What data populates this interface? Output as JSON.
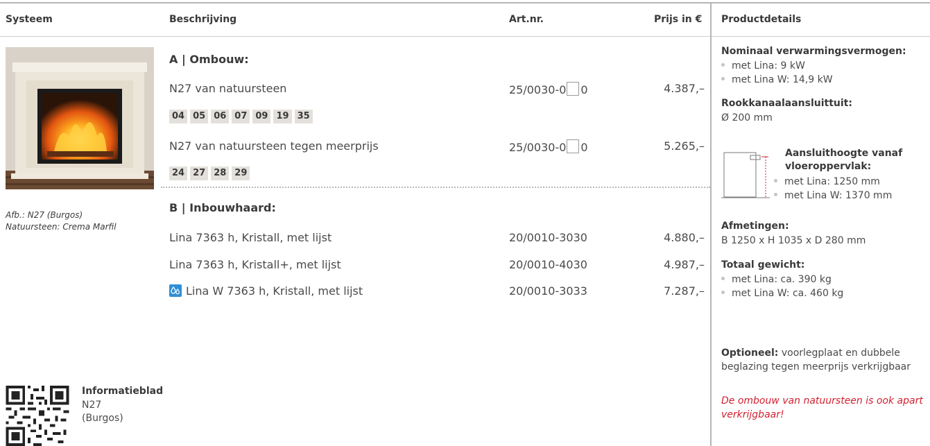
{
  "header": {
    "systeem": "Systeem",
    "beschrijving": "Beschrijving",
    "artnr": "Art.nr.",
    "prijs": "Prijs in €",
    "productdetails": "Productdetails"
  },
  "image": {
    "caption_line1": "Afb.: N27 (Burgos)",
    "caption_line2": "Natuursteen: Crema Marfil"
  },
  "section_a": {
    "title": "A | Ombouw:",
    "rows": [
      {
        "desc": "N27 van natuursteen",
        "art_prefix": "25/0030-0",
        "art_suffix": "0",
        "price": "4.387,–"
      },
      {
        "desc": "N27 van natuursteen tegen meerprijs",
        "art_prefix": "25/0030-0",
        "art_suffix": "0",
        "price": "5.265,–"
      }
    ],
    "swatches_1": [
      "04",
      "05",
      "06",
      "07",
      "09",
      "19",
      "35"
    ],
    "swatches_2": [
      "24",
      "27",
      "28",
      "29"
    ]
  },
  "section_b": {
    "title": "B | Inbouwhaard:",
    "rows": [
      {
        "desc": "Lina 7363 h, Kristall, met lijst",
        "art": "20/0010-3030",
        "price": "4.880,–"
      },
      {
        "desc": "Lina 7363 h, Kristall+, met lijst",
        "art": "20/0010-4030",
        "price": "4.987,–"
      },
      {
        "desc": "Lina W 7363 h, Kristall, met lijst",
        "art": "20/0010-3033",
        "price": "7.287,–",
        "icon": "water-drops-icon"
      }
    ]
  },
  "info": {
    "title": "Informatieblad",
    "line1": "N27",
    "line2": "(Burgos)"
  },
  "details": {
    "power_title": "Nominaal verwarmingsvermogen:",
    "power_items": [
      "met Lina: 9 kW",
      "met Lina W: 14,9 kW"
    ],
    "flue_title": "Rookkanaalaansluittuit:",
    "flue_value": "Ø 200 mm",
    "height_title_1": "Aansluithoogte vanaf",
    "height_title_2": "vloeroppervlak:",
    "height_items": [
      "met Lina: 1250 mm",
      "met Lina W: 1370 mm"
    ],
    "dims_title": "Afmetingen:",
    "dims_value": "B 1250 x H 1035 x D 280 mm",
    "weight_title": "Totaal gewicht:",
    "weight_items": [
      "met Lina: ca. 390 kg",
      "met Lina W: ca. 460 kg"
    ],
    "optional_label": "Optioneel:",
    "optional_text": " voorlegplaat en dubbele beglazing tegen meerprijs verkrijgbaar",
    "note": "De ombouw van natuursteen is ook apart verkrijgbaar!"
  },
  "colors": {
    "accent_red": "#d11f2f",
    "icon_blue": "#2f8fd6",
    "swatch_bg": "#e3e0dc"
  }
}
